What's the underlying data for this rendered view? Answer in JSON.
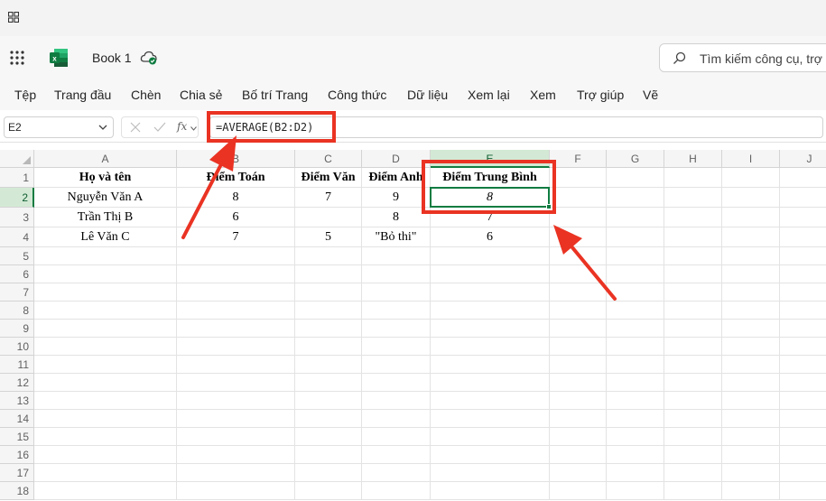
{
  "app": {
    "title": "Book 1",
    "search_placeholder": "Tìm kiếm công cụ, trợ giúp",
    "accent": "#107c41",
    "annotation_color": "#ea3323"
  },
  "ribbon": {
    "tabs": [
      "Tệp",
      "Trang đầu",
      "Chèn",
      "Chia sẻ",
      "Bố trí Trang",
      "Công thức",
      "Dữ liệu",
      "Xem lại",
      "Xem",
      "Trợ giúp",
      "Vẽ"
    ]
  },
  "formula_bar": {
    "name_box": "E2",
    "fx_label": "fx",
    "formula": "=AVERAGE(B2:D2)"
  },
  "grid": {
    "columns": [
      "A",
      "B",
      "C",
      "D",
      "E",
      "F",
      "G",
      "H",
      "I",
      "J"
    ],
    "rows": [
      "1",
      "2",
      "3",
      "4",
      "5",
      "6",
      "7",
      "8",
      "9",
      "10",
      "11",
      "12",
      "13",
      "14",
      "15",
      "16",
      "17",
      "18"
    ],
    "selected_column": "E",
    "selected_row": "2",
    "headers": [
      "Họ và tên",
      "Điểm Toán",
      "Điểm Văn",
      "Điểm Anh",
      "Điểm Trung Bình"
    ],
    "data": [
      [
        "Nguyễn Văn A",
        "8",
        "7",
        "9",
        "8"
      ],
      [
        "Trần Thị B",
        "6",
        "",
        "8",
        "7"
      ],
      [
        "Lê Văn C",
        "7",
        "5",
        "\"Bỏ thi\"",
        "6"
      ]
    ]
  }
}
